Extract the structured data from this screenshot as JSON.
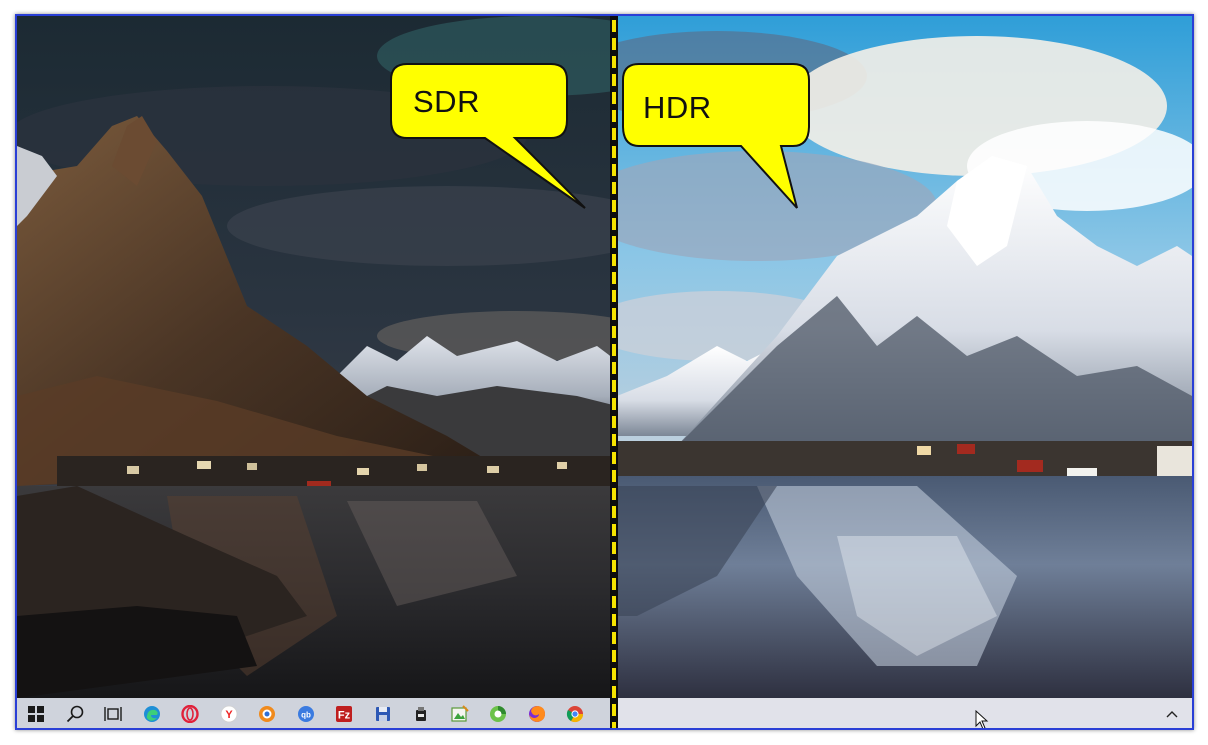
{
  "comparison": {
    "left_label": "SDR",
    "right_label": "HDR"
  },
  "taskbar": {
    "icons": [
      "windows-start-icon",
      "search-icon",
      "task-view-icon",
      "edge-browser-icon",
      "opera-browser-icon",
      "yandex-browser-icon",
      "security-app-icon",
      "qbittorrent-icon",
      "filezilla-icon",
      "save-disk-icon",
      "usb-device-icon",
      "image-editor-icon",
      "cleaner-app-icon",
      "firefox-icon",
      "chrome-icon"
    ],
    "active": [
      "firefox-icon",
      "chrome-icon"
    ]
  },
  "tray": {
    "chevron": "chevron-up-icon"
  },
  "colors": {
    "frame_border": "#2a3fd6",
    "callout_fill": "#ffff00",
    "divider_dash": "#f6e400",
    "taskbar_left": "#cfd3dc",
    "taskbar_right": "#e1e2ea"
  }
}
